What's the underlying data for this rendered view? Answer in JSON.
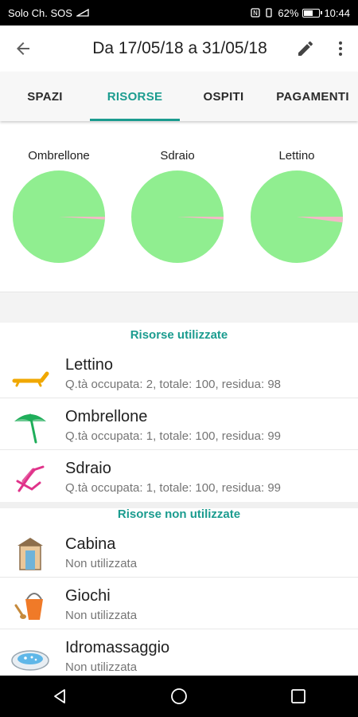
{
  "status": {
    "carrier": "Solo Ch. SOS",
    "battery": "62%",
    "battery_level": 0.62,
    "time": "10:44"
  },
  "appbar": {
    "title": "Da 17/05/18 a 31/05/18",
    "icons": [
      "arrow-back-icon",
      "pencil-icon",
      "more-vert-icon"
    ]
  },
  "tabs": [
    {
      "label": "SPAZI",
      "active": false
    },
    {
      "label": "RISORSE",
      "active": true
    },
    {
      "label": "OSPITI",
      "active": false
    },
    {
      "label": "PAGAMENTI",
      "active": false
    }
  ],
  "charts": [
    {
      "label": "Ombrellone",
      "used": 1,
      "total": 100
    },
    {
      "label": "Sdraio",
      "used": 1,
      "total": 100
    },
    {
      "label": "Lettino",
      "used": 2,
      "total": 100
    }
  ],
  "colors": {
    "accent": "#1b9c8f",
    "pie_free": "#90ee90",
    "pie_used": "#f4b8c6"
  },
  "used_section": {
    "title": "Risorse utilizzate",
    "items": [
      {
        "name": "Lettino",
        "detail": "Q.tà occupata: 2, totale: 100, residua: 98",
        "icon": "sunbed-icon"
      },
      {
        "name": "Ombrellone",
        "detail": "Q.tà occupata: 1, totale: 100, residua: 99",
        "icon": "umbrella-icon"
      },
      {
        "name": "Sdraio",
        "detail": "Q.tà occupata: 1, totale: 100, residua: 99",
        "icon": "deckchair-icon"
      }
    ]
  },
  "unused_section": {
    "title": "Risorse non utilizzate",
    "items": [
      {
        "name": "Cabina",
        "detail": "Non utilizzata",
        "icon": "cabin-icon"
      },
      {
        "name": "Giochi",
        "detail": "Non utilizzata",
        "icon": "sand-bucket-icon"
      },
      {
        "name": "Idromassaggio",
        "detail": "Non utilizzata",
        "icon": "hot-tub-icon"
      }
    ]
  },
  "navbar": [
    "back-nav-icon",
    "home-nav-icon",
    "recents-nav-icon"
  ]
}
